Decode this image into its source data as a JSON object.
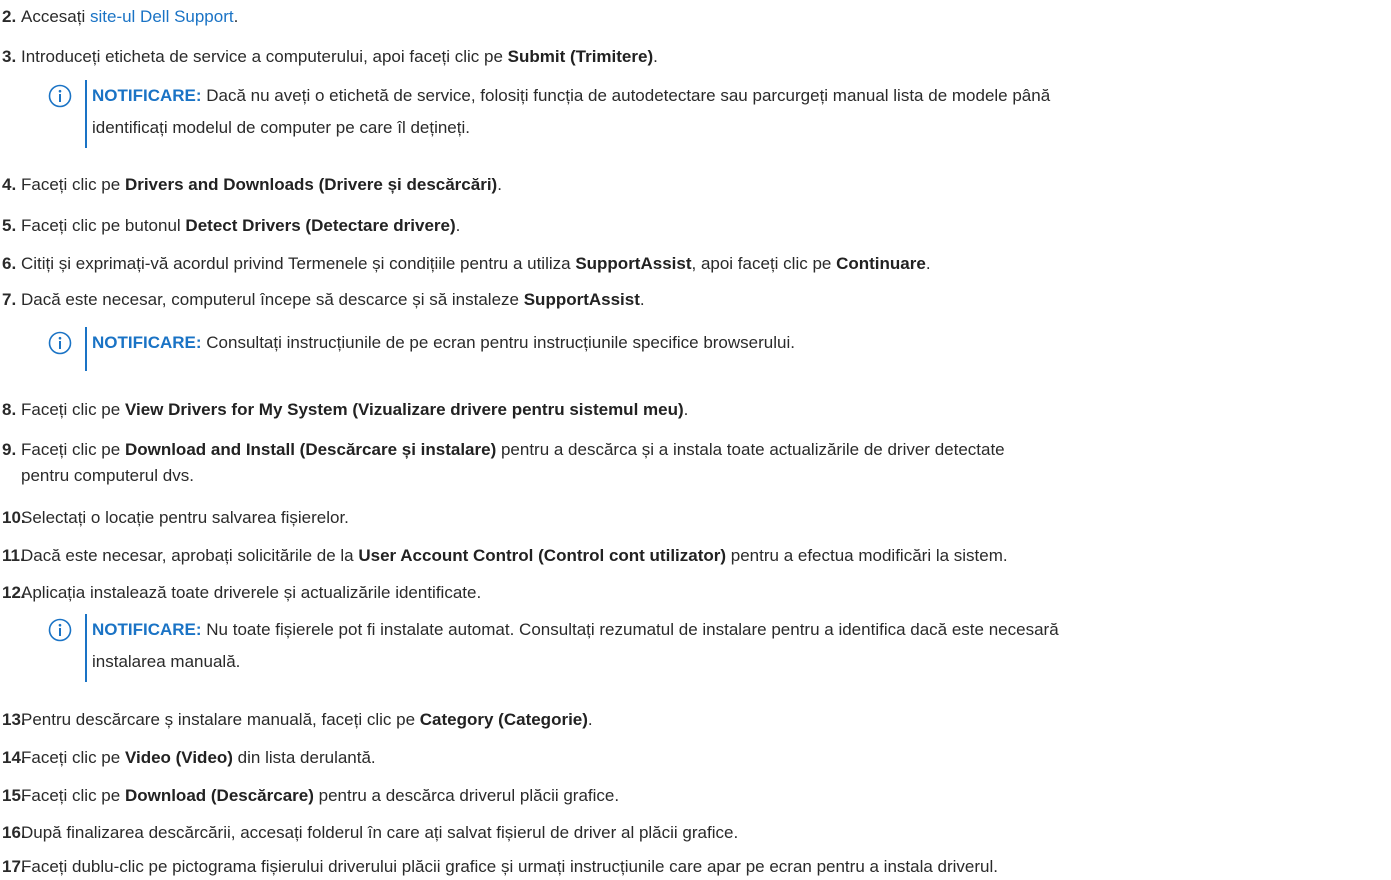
{
  "accent_color": "#1a73c5",
  "note_icon": "info-circle-icon",
  "steps": [
    {
      "num": "2.",
      "pre": "Accesați ",
      "link": "site-ul Dell Support",
      "post": "."
    },
    {
      "num": "3.",
      "pre": "Introduceți eticheta de service a computerului, apoi faceți clic pe ",
      "bold": "Submit (Trimitere)",
      "post": "."
    },
    {
      "num": "4.",
      "pre": "Faceți clic pe ",
      "bold": "Drivers and Downloads (Drivere și descărcări)",
      "post": "."
    },
    {
      "num": "5.",
      "pre": "Faceți clic pe butonul ",
      "bold": "Detect Drivers (Detectare drivere)",
      "post": "."
    },
    {
      "num": "6.",
      "pre": "Citiți și exprimați-vă acordul privind Termenele și condițiile pentru a utiliza ",
      "bold": "SupportAssist",
      "mid": ", apoi faceți clic pe ",
      "bold2": "Continuare",
      "post": "."
    },
    {
      "num": "7.",
      "pre": "Dacă este necesar, computerul începe să descarce și să instaleze ",
      "bold": "SupportAssist",
      "post": "."
    },
    {
      "num": "8.",
      "pre": "Faceți clic pe ",
      "bold": "View Drivers for My System (Vizualizare drivere pentru sistemul meu)",
      "post": "."
    },
    {
      "num": "9.",
      "pre": "Faceți clic pe ",
      "bold": "Download and Install (Descărcare și instalare)",
      "post": " pentru a descărca și a instala toate actualizările de driver detectate",
      "line2": "pentru computerul dvs."
    },
    {
      "num": "10.",
      "pre": "Selectați o locație pentru salvarea fișierelor."
    },
    {
      "num": "11.",
      "pre": "Dacă este necesar, aprobați solicitările de la ",
      "bold": "User Account Control (Control cont utilizator)",
      "post": " pentru a efectua modificări la sistem."
    },
    {
      "num": "12.",
      "pre": "Aplicația instalează toate driverele și actualizările identificate."
    },
    {
      "num": "13.",
      "pre": "Pentru descărcare ș instalare manuală, faceți clic pe ",
      "bold": "Category (Categorie)",
      "post": "."
    },
    {
      "num": "14.",
      "pre": "Faceți clic pe ",
      "bold": "Video (Video)",
      "post": " din lista derulantă."
    },
    {
      "num": "15.",
      "pre": "Faceți clic pe ",
      "bold": "Download (Descărcare)",
      "post": " pentru a descărca driverul plăcii grafice."
    },
    {
      "num": "16.",
      "pre": "După finalizarea descărcării, accesați folderul în care ați salvat fișierul de driver al plăcii grafice."
    },
    {
      "num": "17.",
      "pre": "Faceți dublu-clic pe pictograma fișierului driverului plăcii grafice și urmați instrucțiunile care apar pe ecran pentru a instala driverul."
    }
  ],
  "notes": [
    {
      "label": "NOTIFICARE:",
      "line1": " Dacă nu aveți o etichetă de service, folosiți funcția de autodetectare sau parcurgeți manual lista de modele până",
      "line2": "identificați modelul de computer pe care îl dețineți."
    },
    {
      "label": "NOTIFICARE:",
      "line1": " Consultați instrucțiunile de pe ecran pentru instrucțiunile specifice browserului."
    },
    {
      "label": "NOTIFICARE:",
      "line1": " Nu toate fișierele pot fi instalate automat. Consultați rezumatul de instalare pentru a identifica dacă este necesară",
      "line2": "instalarea manuală."
    }
  ]
}
